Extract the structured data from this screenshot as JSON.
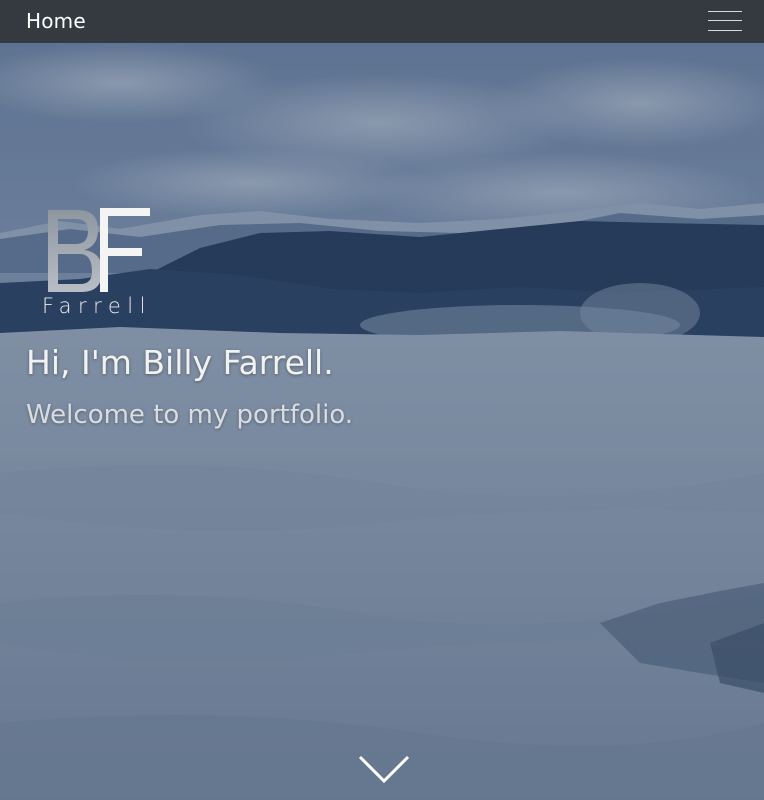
{
  "navbar": {
    "title": "Home",
    "menu_icon": "hamburger-menu-icon"
  },
  "hero": {
    "logo_mark": "BF",
    "logo_text": "Farrell",
    "heading": "Hi, I'm Billy Farrell.",
    "subheading": "Welcome to my portfolio.",
    "scroll_icon": "chevron-down-icon"
  },
  "colors": {
    "navbar_bg": "#343a40",
    "overlay": "#284064",
    "text": "#f2f2f2"
  }
}
